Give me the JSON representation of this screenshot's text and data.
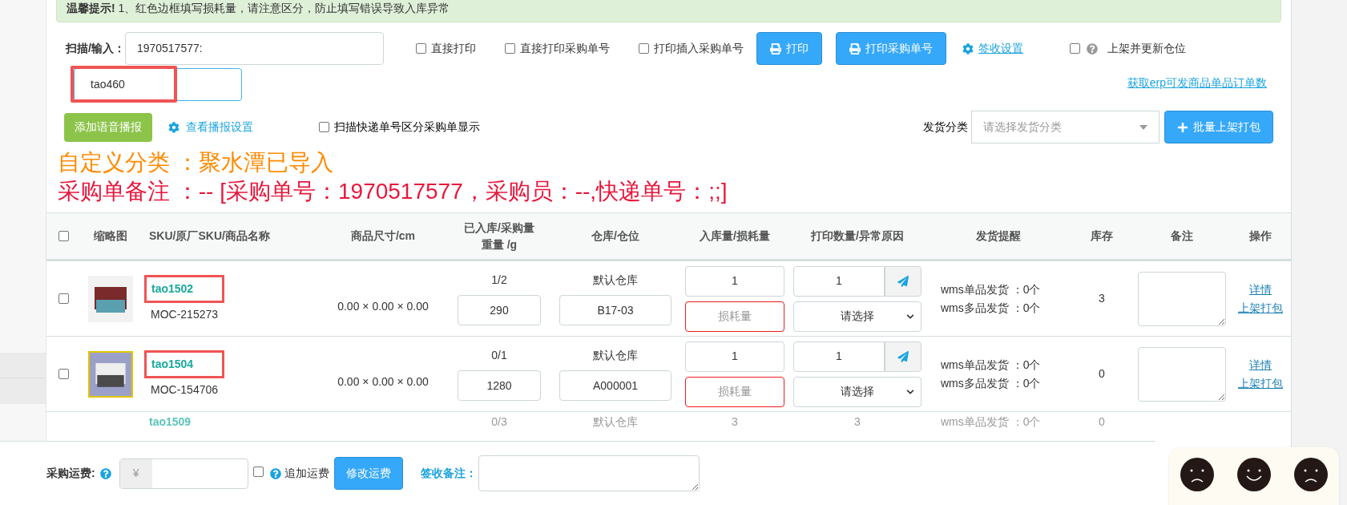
{
  "notice": "**温馨提示!** 1、红色边框填写损耗量，请注意区分，防止填写错误导致入库异常",
  "scan": {
    "label": "扫描/输入：",
    "value": "1970517577:"
  },
  "sku_input": {
    "value": "tao460",
    "highlighted": true
  },
  "options": [
    {
      "label": "直接打印",
      "checked": false
    },
    {
      "label": "直接打印采购单号",
      "checked": false
    },
    {
      "label": "打印插入采购单号",
      "checked": false
    }
  ],
  "print_buttons": [
    "打印",
    "打印采购单号"
  ],
  "sign_settings": "签收设置",
  "shelf_update": {
    "label": "上架并更新仓位",
    "checked": false
  },
  "erp_link": "获取erp可发商品单品订单数",
  "voice_button": "添加语音播报",
  "broadcast_settings": "查看播报设置",
  "express_option": {
    "label": "扫描快递单号区分采购单显示",
    "checked": false
  },
  "ship_category": {
    "label": "发货分类",
    "placeholder": "请选择发货分类"
  },
  "batch_button": "批量上架打包",
  "custom_category": "自定义分类 ：聚水潭已导入",
  "po_remark": "采购单备注 ：-- [采购单号：1970517577，采购员：--,快递单号：;;]",
  "table": {
    "select_all": false,
    "columns": [
      "缩略图",
      "SKU/原厂SKU/商品名称",
      "商品尺寸/cm",
      "已入库/采购量重量 /g",
      "仓库/仓位",
      "入库量/损耗量",
      "打印数量/异常原因",
      "发货提醒",
      "库存",
      "备注",
      "操作"
    ],
    "rows": [
      {
        "selected": false,
        "sku": "tao1502",
        "highlighted": true,
        "model": "MOC-215273",
        "size": "0.00 × 0.00 × 0.00",
        "qty": "1/2",
        "weight": "290",
        "warehouse": "默认仓库",
        "location": "B17-03",
        "inbound": "1",
        "loss_placeholder": "损耗量",
        "print_qty": "1",
        "reason": "请选择",
        "ship_single": "wms单品发货 ：0个",
        "ship_multi": "wms多品发货 ：0个",
        "stock": "3",
        "actions": [
          "详情",
          "上架打包"
        ]
      },
      {
        "selected": false,
        "sku": "tao1504",
        "highlighted": true,
        "model": "MOC-154706",
        "size": "0.00 × 0.00 × 0.00",
        "qty": "0/1",
        "weight": "1280",
        "warehouse": "默认仓库",
        "location": "A000001",
        "inbound": "1",
        "loss_placeholder": "损耗量",
        "print_qty": "1",
        "reason": "请选择",
        "ship_single": "wms单品发货 ：0个",
        "ship_multi": "wms多品发货 ：0个",
        "stock": "0",
        "actions": [
          "详情",
          "上架打包"
        ]
      }
    ],
    "partial_row": {
      "sku": "tao1509",
      "qty": "0/3",
      "warehouse": "默认仓库",
      "inbound": "3",
      "print_qty": "3",
      "ship_single": "wms单品发货 ：0个",
      "stock": "0"
    }
  },
  "footer": {
    "freight_label": "采购运费:",
    "currency": "¥",
    "extra": {
      "label": "追加运费",
      "checked": false
    },
    "modify_button": "修改运费",
    "sign_remark_label": "签收备注："
  }
}
